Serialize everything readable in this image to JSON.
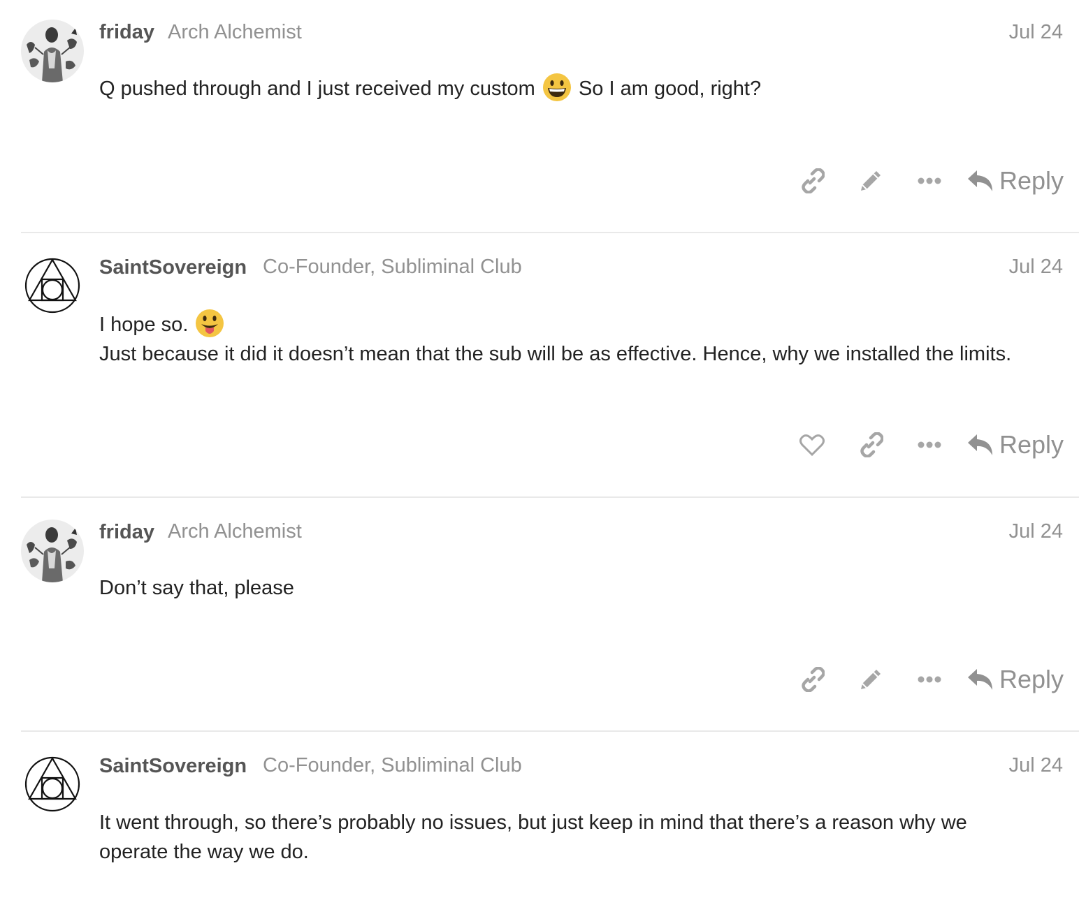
{
  "posts": [
    {
      "username": "friday",
      "title": "Arch Alchemist",
      "date": "Jul 24",
      "avatar_icon": "portrait-avatar",
      "body": {
        "before": "Q pushed through and I just received my custom",
        "emoji": "grinning-emoji",
        "after": "So I am good, right?"
      },
      "reply_label": "Reply"
    },
    {
      "username": "SaintSovereign",
      "title": "Co-Founder, Subliminal Club",
      "date": "Jul 24",
      "avatar_icon": "alchemy-symbol-avatar",
      "body": {
        "line1": "I hope so.",
        "emoji": "tongue-out-emoji",
        "line2": "Just because it did it doesn’t mean that the sub will be as effective. Hence, why we installed the limits."
      },
      "reply_label": "Reply"
    },
    {
      "username": "friday",
      "title": "Arch Alchemist",
      "date": "Jul 24",
      "avatar_icon": "portrait-avatar",
      "body": {
        "text": "Don’t say that, please"
      },
      "reply_label": "Reply"
    },
    {
      "username": "SaintSovereign",
      "title": "Co-Founder, Subliminal Club",
      "date": "Jul 24",
      "avatar_icon": "alchemy-symbol-avatar",
      "body": {
        "text": "It went through, so there’s probably no issues, but just keep in mind that there’s a reason why we operate the way we do."
      }
    }
  ],
  "colors": {
    "muted": "#919191",
    "username": "#555555",
    "text": "#222222",
    "divider": "#e9e9e9"
  }
}
